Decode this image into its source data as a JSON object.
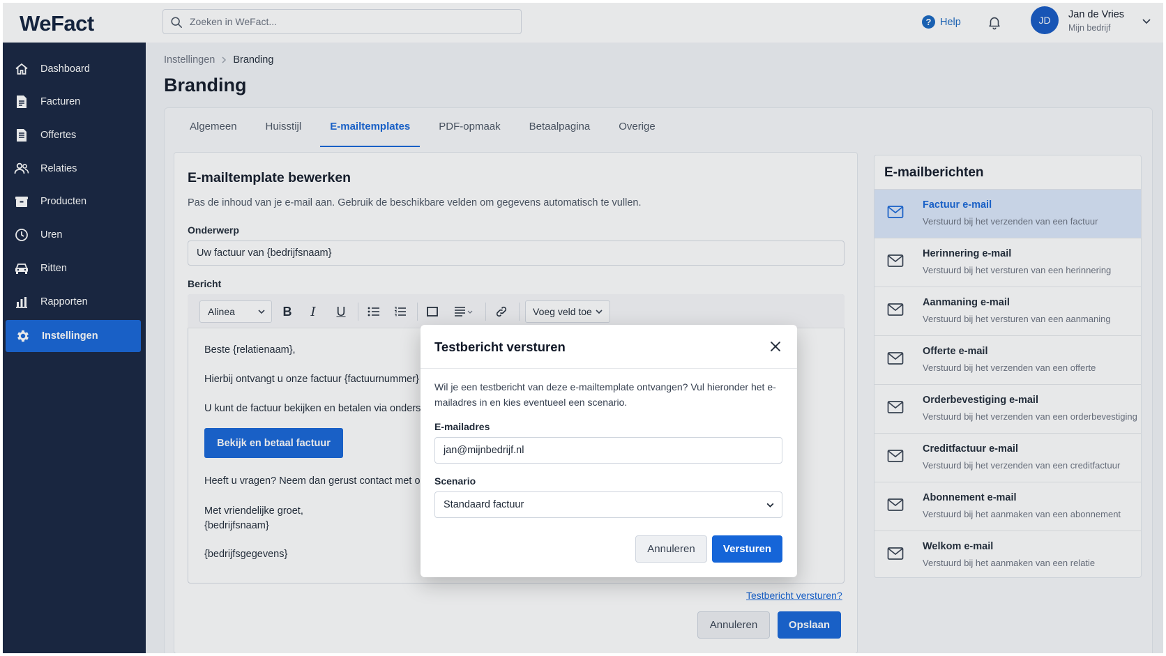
{
  "app": {
    "logo": "WeFact"
  },
  "header": {
    "search_placeholder": "Zoeken in WeFact...",
    "help_label": "Help",
    "avatar_initials": "JD",
    "user_name": "Jan de Vries",
    "user_company": "Mijn bedrijf"
  },
  "sidebar": {
    "items": [
      {
        "label": "Dashboard",
        "icon": "home-icon"
      },
      {
        "label": "Facturen",
        "icon": "invoice-icon"
      },
      {
        "label": "Offertes",
        "icon": "quote-icon"
      },
      {
        "label": "Relaties",
        "icon": "people-icon"
      },
      {
        "label": "Producten",
        "icon": "box-icon"
      },
      {
        "label": "Uren",
        "icon": "clock-icon"
      },
      {
        "label": "Ritten",
        "icon": "car-icon"
      },
      {
        "label": "Rapporten",
        "icon": "report-icon"
      },
      {
        "label": "Instellingen",
        "icon": "gear-icon",
        "active": true
      }
    ]
  },
  "breadcrumb": {
    "parent": "Instellingen",
    "current": "Branding"
  },
  "page": {
    "title": "Branding"
  },
  "tabs": [
    {
      "label": "Algemeen"
    },
    {
      "label": "Huisstijl"
    },
    {
      "label": "E-mailtemplates",
      "active": true
    },
    {
      "label": "PDF-opmaak"
    },
    {
      "label": "Betaalpagina"
    },
    {
      "label": "Overige"
    }
  ],
  "editor": {
    "title": "E-mailtemplate bewerken",
    "subtitle": "Pas de inhoud van je e-mail aan. Gebruik de beschikbare velden om gegevens automatisch te vullen.",
    "subject_label": "Onderwerp",
    "subject_value": "Uw factuur van {bedrijfsnaam}",
    "message_label": "Bericht",
    "toolbar": {
      "block_format": "Alinea",
      "insert_field": "Voeg veld toe"
    },
    "body": {
      "greeting": "Beste {relatienaam},",
      "line1": "Hierbij ontvangt u onze factuur {factuurnummer}",
      "line2": "U kunt de factuur bekijken en betalen via onderst",
      "cta": "Bekijk en betaal factuur",
      "line3": "Heeft u vragen? Neem dan gerust contact met or",
      "closing": "Met vriendelijke groet,",
      "company": "{bedrijfsnaam}",
      "details": "{bedrijfsgegevens}"
    },
    "test_link": "Testbericht versturen?",
    "cancel_label": "Annuleren",
    "save_label": "Opslaan"
  },
  "mail_list": {
    "title": "E-mailberichten",
    "items": [
      {
        "title": "Factuur e-mail",
        "desc": "Verstuurd bij het verzenden van een factuur",
        "active": true
      },
      {
        "title": "Herinnering e-mail",
        "desc": "Verstuurd bij het versturen van een herinnering"
      },
      {
        "title": "Aanmaning e-mail",
        "desc": "Verstuurd bij het versturen van een aanmaning"
      },
      {
        "title": "Offerte e-mail",
        "desc": "Verstuurd bij het verzenden van een offerte"
      },
      {
        "title": "Orderbevestiging e-mail",
        "desc": "Verstuurd bij het verzenden van een orderbevestiging"
      },
      {
        "title": "Creditfactuur e-mail",
        "desc": "Verstuurd bij het verzenden van een creditfactuur"
      },
      {
        "title": "Abonnement e-mail",
        "desc": "Verstuurd bij het aanmaken van een abonnement"
      },
      {
        "title": "Welkom e-mail",
        "desc": "Verstuurd bij het aanmaken van een relatie"
      }
    ]
  },
  "modal": {
    "title": "Testbericht versturen",
    "description": "Wil je een testbericht van deze e-mailtemplate ontvangen? Vul hieronder het e-mailadres in en kies eventueel een scenario.",
    "email_label": "E-mailadres",
    "email_value": "jan@mijnbedrijf.nl",
    "scenario_label": "Scenario",
    "scenario_value": "Standaard factuur",
    "cancel_label": "Annuleren",
    "send_label": "Versturen"
  },
  "colors": {
    "accent": "#1565d8",
    "sidebar": "#15233f",
    "active_item_bg": "#dbe8fb"
  }
}
